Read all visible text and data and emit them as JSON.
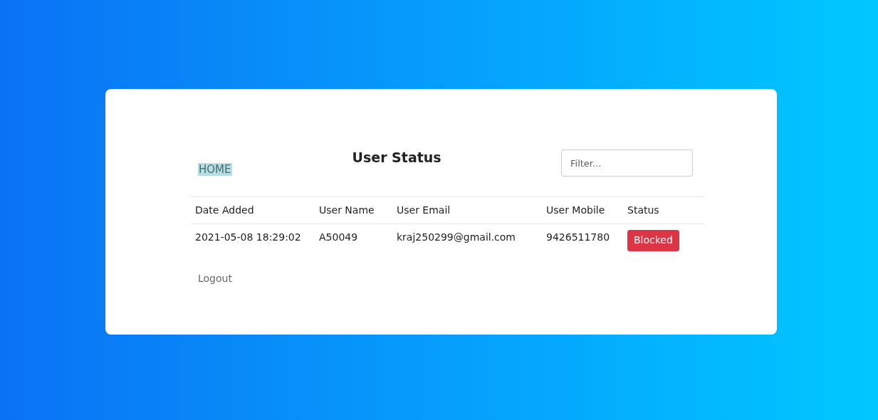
{
  "nav": {
    "home_link": "HOME",
    "title": "User Status"
  },
  "filter": {
    "placeholder": "Filter..."
  },
  "table": {
    "columns": [
      "Date Added",
      "User Name",
      "User Email",
      "User Mobile",
      "Status"
    ],
    "rows": [
      {
        "date_added": "2021-05-08 18:29:02",
        "user_name": "A50049",
        "user_email": "kraj250299@gmail.com",
        "user_mobile": "9426511780",
        "status": {
          "label": "Blocked",
          "kind": "blocked"
        }
      }
    ]
  },
  "logout_link": "Logout"
}
